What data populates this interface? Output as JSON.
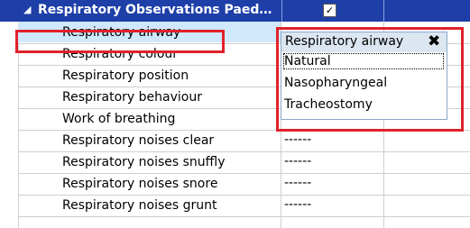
{
  "header": {
    "title": "Respiratory Observations Paed…",
    "expander": "◢",
    "checkbox_mark": "✓"
  },
  "rows": [
    {
      "label": "Respiratory airway",
      "value": ""
    },
    {
      "label": "Respiratory colour",
      "value": ""
    },
    {
      "label": "Respiratory position",
      "value": ""
    },
    {
      "label": "Respiratory behaviour",
      "value": ""
    },
    {
      "label": "Work of breathing",
      "value": "------"
    },
    {
      "label": "Respiratory noises clear",
      "value": "------"
    },
    {
      "label": "Respiratory noises snuffly",
      "value": "------"
    },
    {
      "label": "Respiratory noises snore",
      "value": "------"
    },
    {
      "label": "Respiratory noises grunt",
      "value": "------"
    }
  ],
  "dropdown": {
    "title": "Respiratory airway",
    "close": "✖",
    "options": [
      "Natural",
      "Nasopharyngeal",
      "Tracheostomy"
    ]
  },
  "colors": {
    "header": "#1e3fa8",
    "highlight": "#e0222b",
    "selected_row": "#cfe8fb"
  }
}
